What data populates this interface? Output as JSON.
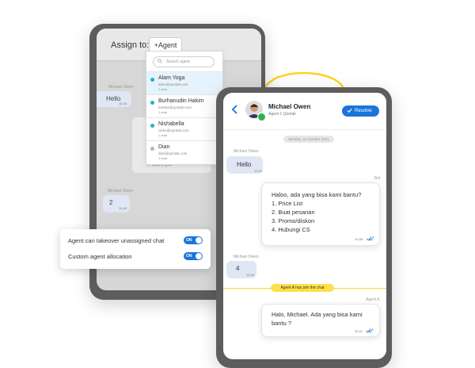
{
  "back_panel": {
    "assign_label": "Assign to:",
    "agent_button": "+Agent",
    "search_placeholder": "Search agent",
    "agents": [
      {
        "name": "Alam Yoga",
        "email": "alam@qontak.com",
        "chats": "1 chat",
        "status_color": "#22b5b8",
        "selected": true
      },
      {
        "name": "Burhanudin Hakim",
        "email": "burhan@qontak.com",
        "chats": "1 chat",
        "status_color": "#22b5b8",
        "selected": false
      },
      {
        "name": "Nishabella",
        "email": "nisha@qontak.com",
        "chats": "1 chat",
        "status_color": "#22b5b8",
        "selected": false
      },
      {
        "name": "Dian",
        "email": "dian@qontak.com",
        "chats": "1 chat",
        "status_color": "#b5b5b5",
        "selected": false
      }
    ],
    "sender_label_1": "Michael Owen",
    "hello_text": "Hello",
    "hello_time": "10.40",
    "lainnya_text": "4. Lainnya",
    "sender_label_2": "Michael Owen",
    "two_text": "2",
    "two_time": "10.40"
  },
  "settings": {
    "row1_label": "Agent can takeover unassigned chat",
    "row1_toggle": "ON",
    "row2_label": "Custom agent allocation",
    "row2_toggle": "ON"
  },
  "chat": {
    "contact_name": "Michael Owen",
    "contact_sub": "Agent 1 Qontak",
    "resolve_label": "Resolve",
    "date_label": "Monday, 11 October 2021",
    "msg1_sender": "Michael Owen",
    "msg1_text": "Hello",
    "msg1_time": "10.40",
    "bot_label": "Bot",
    "bot_lines": [
      "Haloo, ada yang bisa kami bantu?",
      "1. Price List",
      "2. Buat pesanan",
      "3. Promo/diskon",
      "4. Hubungi CS"
    ],
    "bot_time": "10.38",
    "msg2_sender": "Michael Owen",
    "msg2_text": "4",
    "msg2_time": "10.40",
    "system_text": "Agent A has join the chat",
    "agent_label": "Agent A",
    "agent_lines": [
      "Halo, Michael. Ada yang bisa kami",
      "bantu ?"
    ],
    "agent_time": "10.41"
  },
  "colors": {
    "accent": "#1b75d9",
    "highlight_yellow": "#ffd21f",
    "online": "#22b5b8",
    "whatsapp": "#2bb34a"
  }
}
